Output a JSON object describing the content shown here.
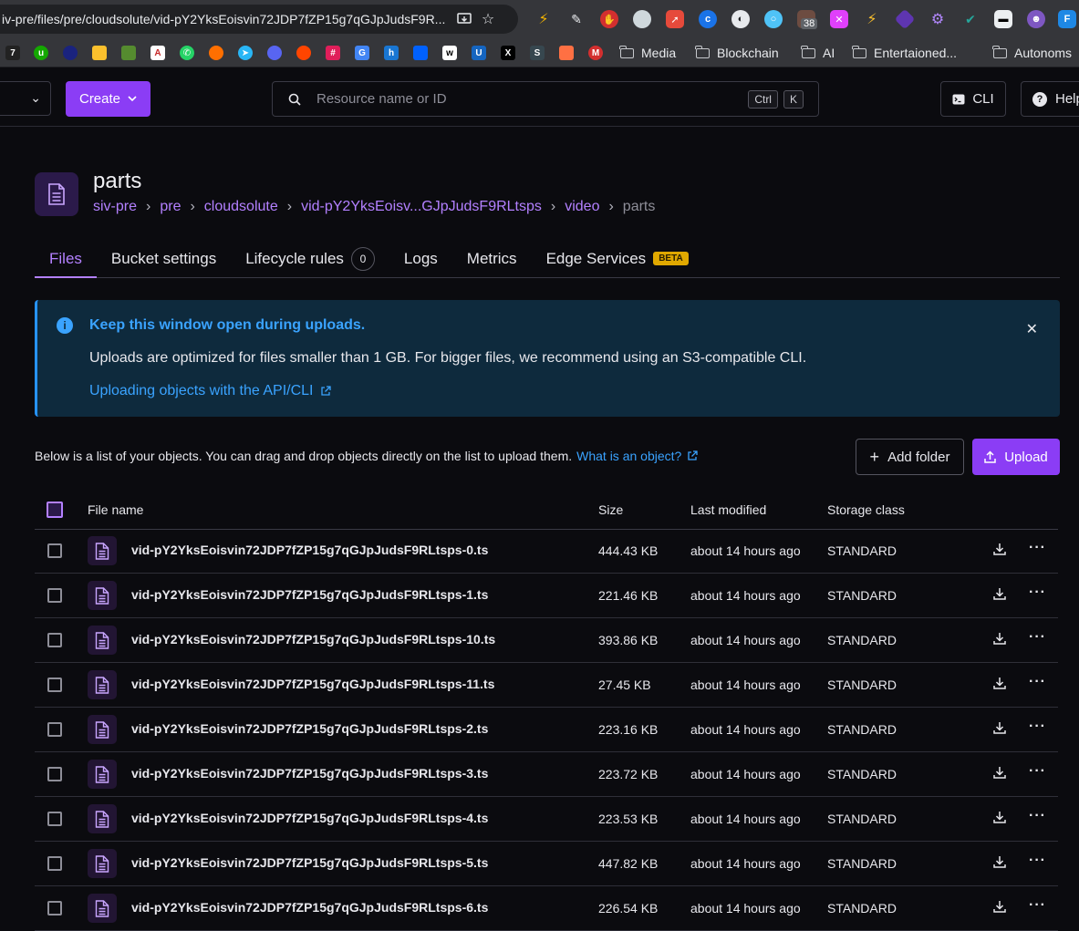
{
  "browser": {
    "url": "iv-pre/files/pre/cloudsolute/vid-pY2YksEoisvin72JDP7fZP15g7qGJpJudsF9R...",
    "extension_badge": "38",
    "bookmark_folders": [
      "Media",
      "Blockchain",
      "AI",
      "Entertaioned...",
      "Autonoms"
    ]
  },
  "header": {
    "create_label": "Create",
    "search_placeholder": "Resource name or ID",
    "shortcut_ctrl": "Ctrl",
    "shortcut_k": "K",
    "cli_label": "CLI",
    "help_label": "Help"
  },
  "page": {
    "title": "parts",
    "breadcrumb": [
      "siv-pre",
      "pre",
      "cloudsolute",
      "vid-pY2YksEoisv...GJpJudsF9RLtsps",
      "video",
      "parts"
    ]
  },
  "tabs": [
    {
      "label": "Files",
      "active": true
    },
    {
      "label": "Bucket settings"
    },
    {
      "label": "Lifecycle rules",
      "count": "0"
    },
    {
      "label": "Logs"
    },
    {
      "label": "Metrics"
    },
    {
      "label": "Edge Services",
      "badge": "BETA"
    }
  ],
  "notice": {
    "title": "Keep this window open during uploads.",
    "text": "Uploads are optimized for files smaller than 1 GB. For bigger files, we recommend using an S3-compatible CLI.",
    "link": "Uploading objects with the API/CLI"
  },
  "intro": {
    "text": "Below is a list of your objects. You can drag and drop objects directly on the list to upload them.",
    "link": "What is an object?"
  },
  "actions": {
    "add_folder": "Add folder",
    "upload": "Upload"
  },
  "table": {
    "columns": [
      "File name",
      "Size",
      "Last modified",
      "Storage class"
    ],
    "rows": [
      {
        "name": "vid-pY2YksEoisvin72JDP7fZP15g7qGJpJudsF9RLtsps-0.ts",
        "size": "444.43 KB",
        "modified": "about 14 hours ago",
        "class": "STANDARD"
      },
      {
        "name": "vid-pY2YksEoisvin72JDP7fZP15g7qGJpJudsF9RLtsps-1.ts",
        "size": "221.46 KB",
        "modified": "about 14 hours ago",
        "class": "STANDARD"
      },
      {
        "name": "vid-pY2YksEoisvin72JDP7fZP15g7qGJpJudsF9RLtsps-10.ts",
        "size": "393.86 KB",
        "modified": "about 14 hours ago",
        "class": "STANDARD"
      },
      {
        "name": "vid-pY2YksEoisvin72JDP7fZP15g7qGJpJudsF9RLtsps-11.ts",
        "size": "27.45 KB",
        "modified": "about 14 hours ago",
        "class": "STANDARD"
      },
      {
        "name": "vid-pY2YksEoisvin72JDP7fZP15g7qGJpJudsF9RLtsps-2.ts",
        "size": "223.16 KB",
        "modified": "about 14 hours ago",
        "class": "STANDARD"
      },
      {
        "name": "vid-pY2YksEoisvin72JDP7fZP15g7qGJpJudsF9RLtsps-3.ts",
        "size": "223.72 KB",
        "modified": "about 14 hours ago",
        "class": "STANDARD"
      },
      {
        "name": "vid-pY2YksEoisvin72JDP7fZP15g7qGJpJudsF9RLtsps-4.ts",
        "size": "223.53 KB",
        "modified": "about 14 hours ago",
        "class": "STANDARD"
      },
      {
        "name": "vid-pY2YksEoisvin72JDP7fZP15g7qGJpJudsF9RLtsps-5.ts",
        "size": "447.82 KB",
        "modified": "about 14 hours ago",
        "class": "STANDARD"
      },
      {
        "name": "vid-pY2YksEoisvin72JDP7fZP15g7qGJpJudsF9RLtsps-6.ts",
        "size": "226.54 KB",
        "modified": "about 14 hours ago",
        "class": "STANDARD"
      }
    ]
  },
  "colors": {
    "accent": "#8b3df5",
    "link": "#3aa3ff",
    "background": "#0b0b0f"
  }
}
